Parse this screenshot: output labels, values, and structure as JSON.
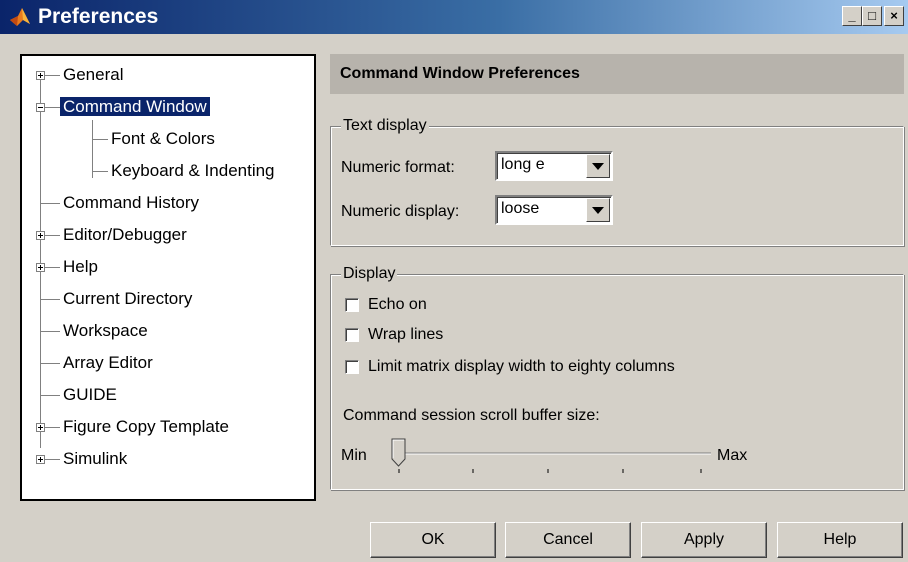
{
  "window": {
    "title": "Preferences",
    "title_icon": "matlab-logo-icon",
    "controls": {
      "minimize": "_",
      "maximize": "□",
      "close": "×"
    }
  },
  "tree": {
    "items": [
      {
        "label": "General",
        "expander": "plus"
      },
      {
        "label": "Command Window",
        "expander": "minus",
        "selected": true
      },
      {
        "label": "Font & Colors"
      },
      {
        "label": "Keyboard & Indenting"
      },
      {
        "label": "Command History"
      },
      {
        "label": "Editor/Debugger",
        "expander": "plus"
      },
      {
        "label": "Help",
        "expander": "plus"
      },
      {
        "label": "Current Directory"
      },
      {
        "label": "Workspace"
      },
      {
        "label": "Array Editor"
      },
      {
        "label": "GUIDE"
      },
      {
        "label": "Figure Copy Template",
        "expander": "plus"
      },
      {
        "label": "Simulink",
        "expander": "plus"
      }
    ]
  },
  "panel": {
    "title": "Command Window Preferences",
    "text_display": {
      "legend": "Text display",
      "numeric_format_label": "Numeric format:",
      "numeric_format_value": "long e",
      "numeric_display_label": "Numeric display:",
      "numeric_display_value": "loose"
    },
    "display": {
      "legend": "Display",
      "echo_on": {
        "label": "Echo on",
        "checked": false
      },
      "wrap_lines": {
        "label": "Wrap lines",
        "checked": false
      },
      "limit_width": {
        "label": "Limit matrix display width to eighty columns",
        "checked": false
      },
      "scroll_buffer_label": "Command session scroll buffer size:",
      "slider": {
        "min_label": "Min",
        "max_label": "Max",
        "value_fraction": 0.0
      }
    }
  },
  "buttons": {
    "ok": "OK",
    "cancel": "Cancel",
    "apply": "Apply",
    "help": "Help"
  }
}
